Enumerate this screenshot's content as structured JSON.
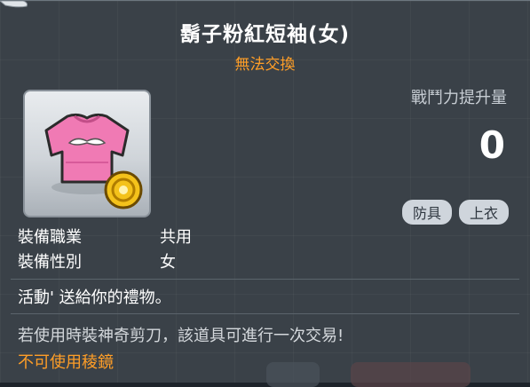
{
  "item": {
    "name": "鬍子粉紅短袖(女)",
    "trade_status": "無法交換",
    "icon": "pink-tshirt-icon",
    "badge_icon": "gold-coin-icon"
  },
  "stats": {
    "power_label": "戰鬥力提升量",
    "power_value": "0"
  },
  "tags": [
    "防具",
    "上衣"
  ],
  "requirements": [
    {
      "label": "裝備職業",
      "value": "共用"
    },
    {
      "label": "裝備性別",
      "value": "女"
    }
  ],
  "description": "活動' 送給你的禮物。",
  "scissors_note": "若使用時裝神奇剪刀，該道具可進行一次交易!",
  "prism_note": "不可使用稜鏡",
  "colors": {
    "title": "#ffffff",
    "accent_orange": "#ff9e27",
    "panel": "#3a4148"
  }
}
